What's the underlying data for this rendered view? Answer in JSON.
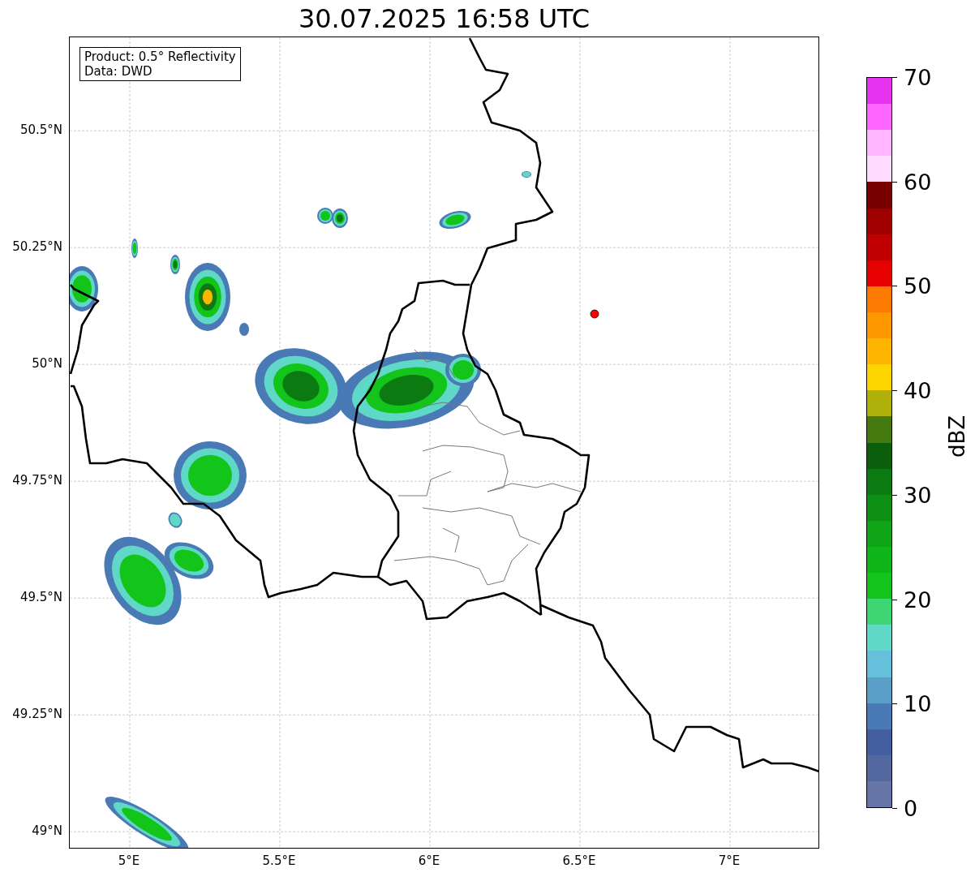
{
  "title": "30.07.2025 16:58 UTC",
  "info_box": {
    "lines": [
      "Product: 0.5° Reflectivity",
      "Data: DWD"
    ]
  },
  "y_ticks": [
    "50.5°N",
    "50.25°N",
    "50°N",
    "49.75°N",
    "49.5°N",
    "49.25°N",
    "49°N"
  ],
  "x_ticks": [
    "5°E",
    "5.5°E",
    "6°E",
    "6.5°E",
    "7°E"
  ],
  "colorbar": {
    "label": "dBZ",
    "ticks": [
      "70",
      "60",
      "50",
      "40",
      "30",
      "20",
      "10",
      "0"
    ],
    "bins": [
      {
        "color": "#e533f0"
      },
      {
        "color": "#ff66ff"
      },
      {
        "color": "#ffb5ff"
      },
      {
        "color": "#ffdcff"
      },
      {
        "color": "#780000"
      },
      {
        "color": "#a00000"
      },
      {
        "color": "#c00000"
      },
      {
        "color": "#e60000"
      },
      {
        "color": "#fd7a00"
      },
      {
        "color": "#fd9800"
      },
      {
        "color": "#fdb500"
      },
      {
        "color": "#fdd600"
      },
      {
        "color": "#b0b00a"
      },
      {
        "color": "#457a0f"
      },
      {
        "color": "#0a5e0c"
      },
      {
        "color": "#0b7a10"
      },
      {
        "color": "#0d8f14"
      },
      {
        "color": "#0fa516"
      },
      {
        "color": "#10b51a"
      },
      {
        "color": "#13c41b"
      },
      {
        "color": "#3ed672"
      },
      {
        "color": "#60d8c8"
      },
      {
        "color": "#65c0dc"
      },
      {
        "color": "#5a9fc8"
      },
      {
        "color": "#4a7ab5"
      },
      {
        "color": "#445fa0"
      },
      {
        "color": "#5468a0"
      },
      {
        "color": "#6675a8"
      }
    ]
  }
}
